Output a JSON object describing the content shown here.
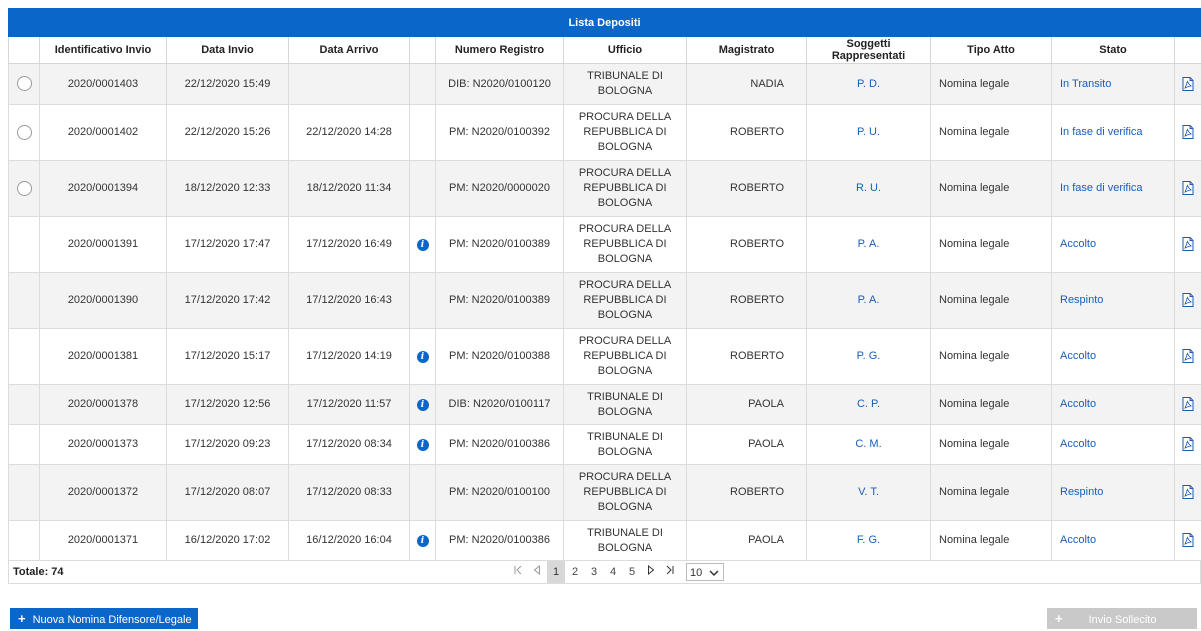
{
  "table": {
    "title": "Lista Depositi",
    "headers": [
      "",
      "Identificativo Invio",
      "Data Invio",
      "Data Arrivo",
      "",
      "Numero Registro",
      "Ufficio",
      "Magistrato",
      "Soggetti Rappresentati",
      "Tipo Atto",
      "Stato",
      ""
    ],
    "rows": [
      {
        "id": "2020/0001403",
        "data_invio": "22/12/2020 15:49",
        "data_arrivo": "",
        "info": false,
        "numero": "DIB: N2020/0100120",
        "ufficio": "TRIBUNALE DI BOLOGNA",
        "magistrato": "NADIA",
        "soggetti": "P. D.",
        "tipo": "Nomina legale",
        "stato": "In Transito",
        "radio": true
      },
      {
        "id": "2020/0001402",
        "data_invio": "22/12/2020 15:26",
        "data_arrivo": "22/12/2020 14:28",
        "info": false,
        "numero": "PM: N2020/0100392",
        "ufficio": "PROCURA DELLA REPUBBLICA DI BOLOGNA",
        "magistrato": "ROBERTO",
        "soggetti": "P. U.",
        "tipo": "Nomina legale",
        "stato": "In fase di verifica",
        "radio": true
      },
      {
        "id": "2020/0001394",
        "data_invio": "18/12/2020 12:33",
        "data_arrivo": "18/12/2020 11:34",
        "info": false,
        "numero": "PM: N2020/0000020",
        "ufficio": "PROCURA DELLA REPUBBLICA DI BOLOGNA",
        "magistrato": "ROBERTO",
        "soggetti": "R. U.",
        "tipo": "Nomina legale",
        "stato": "In fase di verifica",
        "radio": true
      },
      {
        "id": "2020/0001391",
        "data_invio": "17/12/2020 17:47",
        "data_arrivo": "17/12/2020 16:49",
        "info": true,
        "numero": "PM: N2020/0100389",
        "ufficio": "PROCURA DELLA REPUBBLICA DI BOLOGNA",
        "magistrato": "ROBERTO",
        "soggetti": "P. A.",
        "tipo": "Nomina legale",
        "stato": "Accolto",
        "radio": false
      },
      {
        "id": "2020/0001390",
        "data_invio": "17/12/2020 17:42",
        "data_arrivo": "17/12/2020 16:43",
        "info": false,
        "numero": "PM: N2020/0100389",
        "ufficio": "PROCURA DELLA REPUBBLICA DI BOLOGNA",
        "magistrato": "ROBERTO",
        "soggetti": "P. A.",
        "tipo": "Nomina legale",
        "stato": "Respinto",
        "radio": false
      },
      {
        "id": "2020/0001381",
        "data_invio": "17/12/2020 15:17",
        "data_arrivo": "17/12/2020 14:19",
        "info": true,
        "numero": "PM: N2020/0100388",
        "ufficio": "PROCURA DELLA REPUBBLICA DI BOLOGNA",
        "magistrato": "ROBERTO",
        "soggetti": "P. G.",
        "tipo": "Nomina legale",
        "stato": "Accolto",
        "radio": false
      },
      {
        "id": "2020/0001378",
        "data_invio": "17/12/2020 12:56",
        "data_arrivo": "17/12/2020 11:57",
        "info": true,
        "numero": "DIB: N2020/0100117",
        "ufficio": "TRIBUNALE DI BOLOGNA",
        "magistrato": "PAOLA",
        "soggetti": "C. P.",
        "tipo": "Nomina legale",
        "stato": "Accolto",
        "radio": false
      },
      {
        "id": "2020/0001373",
        "data_invio": "17/12/2020 09:23",
        "data_arrivo": "17/12/2020 08:34",
        "info": true,
        "numero": "PM: N2020/0100386",
        "ufficio": "TRIBUNALE DI BOLOGNA",
        "magistrato": "PAOLA",
        "soggetti": "C. M.",
        "tipo": "Nomina legale",
        "stato": "Accolto",
        "radio": false
      },
      {
        "id": "2020/0001372",
        "data_invio": "17/12/2020 08:07",
        "data_arrivo": "17/12/2020 08:33",
        "info": false,
        "numero": "PM: N2020/0100100",
        "ufficio": "PROCURA DELLA REPUBBLICA DI BOLOGNA",
        "magistrato": "ROBERTO",
        "soggetti": "V. T.",
        "tipo": "Nomina legale",
        "stato": "Respinto",
        "radio": false
      },
      {
        "id": "2020/0001371",
        "data_invio": "16/12/2020 17:02",
        "data_arrivo": "16/12/2020 16:04",
        "info": true,
        "numero": "PM: N2020/0100386",
        "ufficio": "TRIBUNALE DI BOLOGNA",
        "magistrato": "PAOLA",
        "soggetti": "F. G.",
        "tipo": "Nomina legale",
        "stato": "Accolto",
        "radio": false
      }
    ]
  },
  "footer": {
    "totale_label": "Totale: 74",
    "pages": [
      "1",
      "2",
      "3",
      "4",
      "5"
    ],
    "current_page": "1",
    "page_size": "10"
  },
  "buttons": {
    "new_label": "Nuova Nomina Difensore/Legale",
    "sollecito_label": "Invio Sollecito"
  },
  "icons": {
    "first": "first-page-icon",
    "prev": "prev-page-icon",
    "next": "next-page-icon",
    "last": "last-page-icon",
    "info": "info-icon",
    "pdf": "pdf-icon"
  },
  "colors": {
    "accent": "#0a67c9",
    "link": "#1a5db4",
    "row_alt": "#f3f3f3",
    "disabled": "#c9c9c9"
  }
}
